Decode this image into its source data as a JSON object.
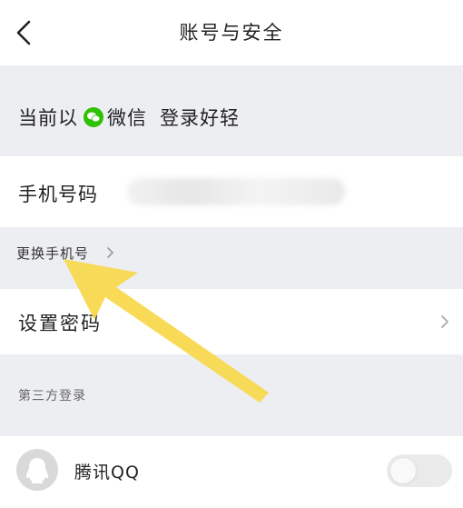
{
  "header": {
    "title": "账号与安全",
    "back_icon": "chevron-left-icon"
  },
  "current_login": {
    "prefix": "当前以",
    "method": "微信",
    "method_icon": "wechat-icon",
    "nickname": "登录好轻",
    "icon_color": "#2dc100"
  },
  "phone": {
    "label": "手机号码"
  },
  "change_phone": {
    "label": "更换手机号"
  },
  "password": {
    "label": "设置密码"
  },
  "third_party": {
    "section_label": "第三方登录",
    "items": [
      {
        "label": "腾讯QQ",
        "icon": "qq-icon",
        "enabled": false
      }
    ]
  },
  "annotation": {
    "type": "arrow",
    "color": "#f8d84e"
  }
}
